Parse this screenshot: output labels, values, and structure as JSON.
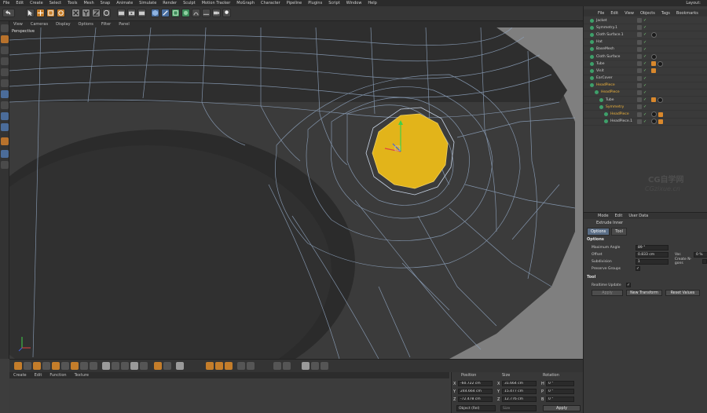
{
  "menubar": {
    "items": [
      "File",
      "Edit",
      "Create",
      "Select",
      "Tools",
      "Mesh",
      "Snap",
      "Animate",
      "Simulate",
      "Render",
      "Sculpt",
      "Motion Tracker",
      "MoGraph",
      "Character",
      "Pipeline",
      "Plugins",
      "Script",
      "Window",
      "Help"
    ],
    "layout_label": "Layout:"
  },
  "viewport": {
    "menu": [
      "View",
      "Cameras",
      "Display",
      "Options",
      "Filter",
      "Panel"
    ],
    "label": "Perspective",
    "colors": {
      "background": "#808080",
      "mesh": "#3a3a3a",
      "wire": "#8fa4bf",
      "selection": "#e2b41a"
    }
  },
  "material_manager": {
    "menu": [
      "Create",
      "Edit",
      "Function",
      "Texture"
    ]
  },
  "coordinates": {
    "headers": {
      "position": "Position",
      "size": "Size",
      "rotation": "Rotation"
    },
    "rows": [
      {
        "axis": "X",
        "position": "-60.722 cm",
        "size_axis": "X",
        "size": "31.664 cm",
        "rot_axis": "H",
        "rotation": "0 °"
      },
      {
        "axis": "Y",
        "position": "244.664 cm",
        "size_axis": "Y",
        "size": "15.477 cm",
        "rot_axis": "P",
        "rotation": "0 °"
      },
      {
        "axis": "Z",
        "position": "-72.478 cm",
        "size_axis": "Z",
        "size": "12.776 cm",
        "rot_axis": "B",
        "rotation": "0 °"
      }
    ],
    "mode_dropdown": "Object (Rel)",
    "size_dropdown": "Size",
    "apply_label": "Apply"
  },
  "object_manager": {
    "menu": [
      "File",
      "Edit",
      "View",
      "Objects",
      "Tags",
      "Bookmarks"
    ],
    "objects": [
      {
        "name": "Jacket",
        "selected": false
      },
      {
        "name": "Symmetry.1",
        "selected": false
      },
      {
        "name": "Cloth Surface.1",
        "selected": false
      },
      {
        "name": "Hat",
        "selected": false
      },
      {
        "name": "BaseMesh",
        "selected": false
      },
      {
        "name": "Cloth Surface",
        "selected": false
      },
      {
        "name": "Tube",
        "selected": false
      },
      {
        "name": "Visit",
        "selected": false
      },
      {
        "name": "EarCover",
        "selected": false
      },
      {
        "name": "HeadPiece",
        "selected": true
      },
      {
        "name": "HeadPiece",
        "selected": true
      },
      {
        "name": "Tube",
        "selected": false
      },
      {
        "name": "Symmetry",
        "selected": true
      },
      {
        "name": "HeadPiece",
        "selected": true
      },
      {
        "name": "HeadPiece.1",
        "selected": false
      }
    ],
    "watermark_main": "CG自学网",
    "watermark_sub": "CGzixue.cn"
  },
  "attribute_manager": {
    "menu": [
      "Mode",
      "Edit",
      "User Data"
    ],
    "tool_name": "Extrude Inner",
    "tabs": [
      "Options",
      "Tool"
    ],
    "options_header": "Options",
    "fields": {
      "max_angle_label": "Maximum Angle",
      "max_angle": "89 °",
      "offset_label": "Offset",
      "offset": "0.833 cm",
      "var_label": "Var.",
      "var": "0 %",
      "subdivision_label": "Subdivision",
      "subdivision": "1",
      "create_ngons_label": "Create N-gons",
      "preserve_groups_label": "Preserve Groups",
      "check_mark": "✓"
    },
    "tool_header": "Tool",
    "realtime_update_label": "Realtime Update",
    "apply_label": "Apply",
    "new_transform_label": "New Transform",
    "reset_values_label": "Reset Values"
  }
}
